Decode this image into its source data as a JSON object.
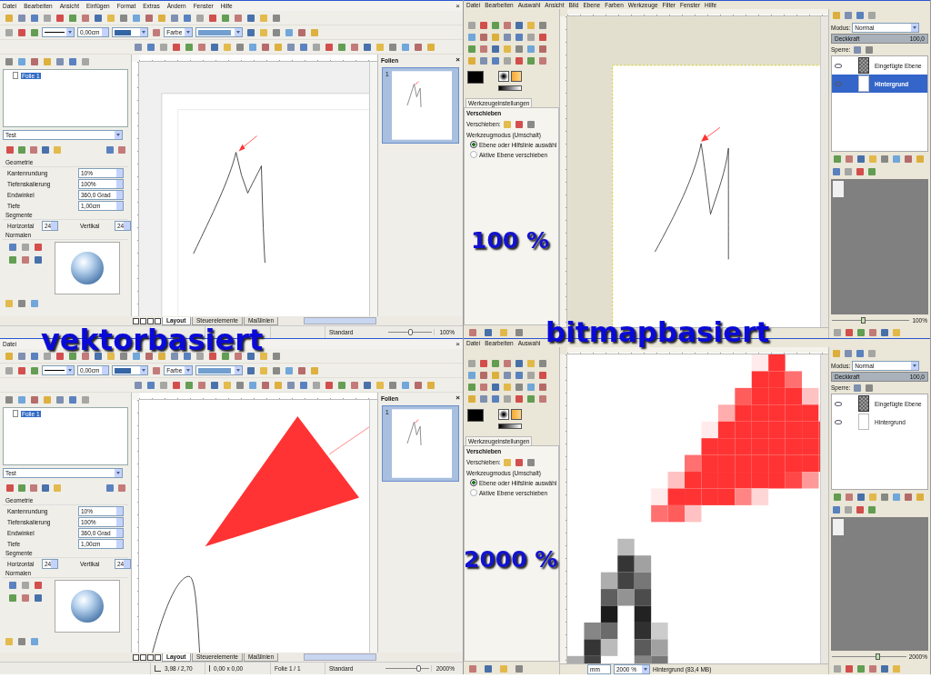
{
  "labels": [
    {
      "kind": "type",
      "text": "vektorbasiert"
    },
    {
      "kind": "type",
      "text": "bitmapbasiert"
    },
    {
      "kind": "zoom",
      "text": "100 %"
    },
    {
      "kind": "zoom",
      "text": "2000 %"
    }
  ],
  "draw_windows": [
    {
      "menu": [
        "Datei",
        "Bearbeiten",
        "Ansicht",
        "Einfügen",
        "Format",
        "Extras",
        "Ändern",
        "Fenster",
        "Hilfe"
      ],
      "close": "×",
      "line_width": "0,00cm",
      "area_fill": "Farbe",
      "tree": [
        {
          "label": "Folie 1",
          "selected": true
        }
      ],
      "style": "Test",
      "geometry_heading": "Geometrie",
      "fields": [
        {
          "label": "Kantenrundung",
          "value": "10%"
        },
        {
          "label": "Tiefenskalierung",
          "value": "100%"
        },
        {
          "label": "Endwinkel",
          "value": "360,0 Grad"
        },
        {
          "label": "Tiefe",
          "value": "1,00cm"
        }
      ],
      "segments_heading": "Segmente",
      "segments": [
        {
          "label": "Horizontal",
          "value": "24"
        },
        {
          "label": "Vertikal",
          "value": "24"
        }
      ],
      "normals_heading": "Normalen",
      "slides_title": "Folien",
      "slides": [
        {
          "number": "1",
          "selected": true
        }
      ],
      "tabs": [
        {
          "label": "Layout",
          "selected": true
        },
        {
          "label": "Steuerelemente",
          "selected": false
        },
        {
          "label": "Maßlinien",
          "selected": false
        }
      ],
      "status": [
        {
          "kind": "position"
        },
        {
          "kind": "size"
        },
        {
          "kind": "cell"
        },
        {
          "kind": "cell",
          "text": "Standard"
        }
      ],
      "zoom": "100%",
      "zoom_slider": {
        "level": 0.5
      },
      "canvas": {
        "kind": "sketch"
      }
    },
    {
      "menu": [
        "Datei"
      ],
      "close": "×",
      "line_width": "0,00cm",
      "area_fill": "Farbe",
      "tree": [
        {
          "label": "Folie 1",
          "selected": true
        }
      ],
      "style": "Test",
      "geometry_heading": "Geometrie",
      "fields": [
        {
          "label": "Kantenrundung",
          "value": "10%"
        },
        {
          "label": "Tiefenskalierung",
          "value": "100%"
        },
        {
          "label": "Endwinkel",
          "value": "360,0 Grad"
        },
        {
          "label": "Tiefe",
          "value": "1,00cm"
        }
      ],
      "segments_heading": "Segmente",
      "segments": [
        {
          "label": "Horizontal",
          "value": "24"
        },
        {
          "label": "Vertikal",
          "value": "24"
        }
      ],
      "normals_heading": "Normalen",
      "slides_title": "Folien",
      "slides": [
        {
          "number": "1",
          "selected": true
        }
      ],
      "tabs": [
        {
          "label": "Layout",
          "selected": true
        },
        {
          "label": "Steuerelemente",
          "selected": false
        },
        {
          "label": "Maßlinien",
          "selected": false
        }
      ],
      "status": [
        {
          "kind": "position",
          "text": "3,98 / 2,70"
        },
        {
          "kind": "size",
          "text": "0,00 x 0,00"
        },
        {
          "kind": "cell",
          "text": "Folie 1 / 1"
        },
        {
          "kind": "cell",
          "text": "Standard"
        }
      ],
      "zoom": "2000%",
      "zoom_slider": {
        "level": 0.8
      },
      "canvas": {
        "kind": "closeup"
      }
    }
  ],
  "gimp_windows": [
    {
      "menu": [
        "Datei",
        "Bearbeiten",
        "Auswahl",
        "Ansicht",
        "Bild",
        "Ebene",
        "Farben",
        "Werkzeuge",
        "Filter",
        "Fenster",
        "Hilfe"
      ],
      "options_tab": "Werkzeugeinstellungen",
      "options_title": "Verschieben",
      "move_label": "Verschieben:",
      "mode_heading": "Werkzeugmodus (Umschalt)",
      "options": [
        {
          "label": "Ebene oder Hilfslinie auswähl",
          "selected": true
        },
        {
          "label": "Aktive Ebene verschieben",
          "selected": false
        }
      ],
      "mode_label": "Modus:",
      "mode": "Normal",
      "opacity_label": "Deckkraft",
      "opacity": "100,0",
      "opacity_bar": {
        "level": 1
      },
      "lock_label": "Sperre:",
      "layers": [
        {
          "name": "Eingefügte Ebene",
          "kind": "transparent",
          "selected": false
        },
        {
          "name": "Hintergrund",
          "kind": "white",
          "selected": true
        }
      ],
      "nav_zoom": "100%",
      "nav_slider": {
        "level": 0.4
      },
      "canvas": {
        "kind": "sketch"
      }
    },
    {
      "menu": [
        "Datei",
        "Bearbeiten",
        "Auswahl"
      ],
      "options_tab": "Werkzeugeinstellungen",
      "options_title": "Verschieben",
      "move_label": "Verschieben:",
      "mode_heading": "Werkzeugmodus (Umschalt)",
      "options": [
        {
          "label": "Ebene oder Hilfslinie auswähl",
          "selected": true
        },
        {
          "label": "Aktive Ebene verschieben",
          "selected": false
        }
      ],
      "mode_label": "Modus:",
      "mode": "Normal",
      "opacity_label": "Deckkraft",
      "opacity": "100,0",
      "opacity_bar": {
        "level": 1
      },
      "lock_label": "Sperre:",
      "layers": [
        {
          "name": "Eingefügte Ebene",
          "kind": "transparent",
          "selected": false
        },
        {
          "name": "Hintergrund",
          "kind": "white",
          "selected": false
        }
      ],
      "nav_zoom": "2000%",
      "nav_slider": {
        "level": 0.62
      },
      "status": {
        "unit": "mm",
        "zoom": "2000 %",
        "info": "Hintergrund (83,4 MB)"
      },
      "canvas": {
        "kind": "pixels"
      }
    }
  ]
}
